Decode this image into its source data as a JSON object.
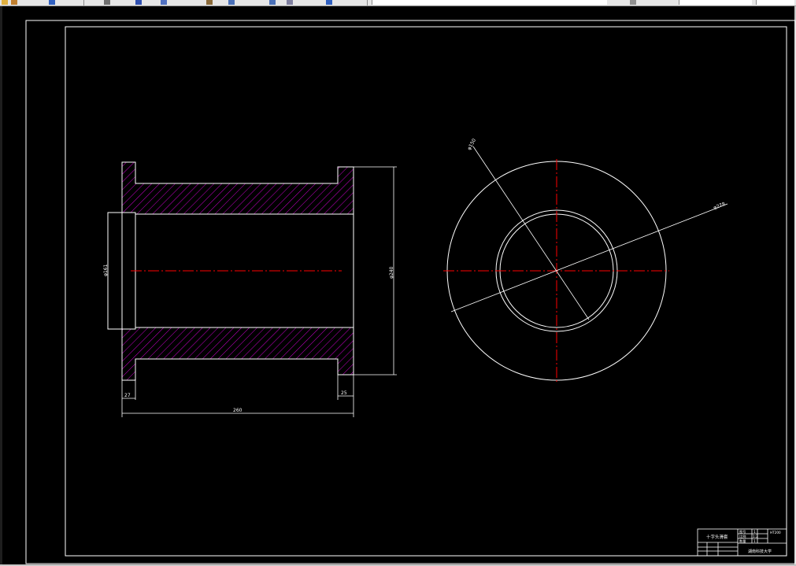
{
  "toolbar": {
    "icons": [
      "new-icon",
      "open-icon",
      "save-icon",
      "print-icon",
      "cut-icon",
      "copy-icon",
      "paste-icon",
      "undo-icon",
      "redo-icon",
      "pan-icon",
      "zoom-icon",
      "properties-icon"
    ]
  },
  "dimensions": {
    "total_length": "260",
    "flange_left": "27",
    "flange_right": "25",
    "bore_dia_left": "φ161",
    "outer_dia_right": "φ240",
    "circle_inner": "φ150",
    "circle_outer": "φ278"
  },
  "title_block": {
    "drawing_name": "十字头滑套",
    "company": "湖南科技大学",
    "drafter": "",
    "row_labels": [
      "图号",
      "比例",
      "数量"
    ],
    "row_values": [
      "1",
      "1:2",
      "1"
    ],
    "material": "HT200"
  },
  "colors": {
    "line": "#ffffff",
    "hatch": "#ff00ff",
    "centerline": "#ff0000",
    "background": "#000000"
  }
}
